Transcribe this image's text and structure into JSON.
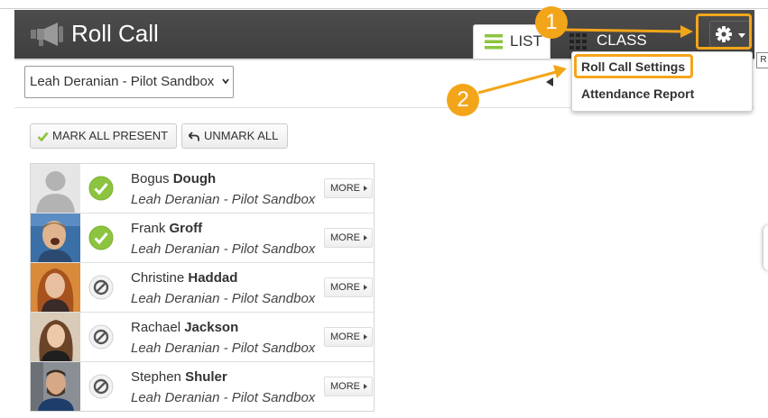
{
  "header": {
    "title": "Roll Call",
    "tabs": [
      {
        "label": "LIST",
        "active": true,
        "icon": "list-icon"
      },
      {
        "label": "CLASS",
        "active": false,
        "icon": "grid-icon"
      }
    ],
    "settings_button_icon": "gear-icon",
    "tooltip_fragment": "R"
  },
  "course_select": {
    "selected": "Leah Deranian - Pilot Sandbox"
  },
  "toolbar": {
    "mark_all_present": "MARK ALL PRESENT",
    "unmark_all": "UNMARK ALL"
  },
  "settings_menu": {
    "items": [
      {
        "label": "Roll Call Settings"
      },
      {
        "label": "Attendance Report"
      }
    ]
  },
  "callouts": [
    {
      "number": "1"
    },
    {
      "number": "2"
    }
  ],
  "students": [
    {
      "first": "Bogus",
      "last": "Dough",
      "course": "Leah Deranian - Pilot Sandbox",
      "status": "present",
      "more": "MORE"
    },
    {
      "first": "Frank",
      "last": "Groff",
      "course": "Leah Deranian - Pilot Sandbox",
      "status": "present",
      "more": "MORE"
    },
    {
      "first": "Christine",
      "last": "Haddad",
      "course": "Leah Deranian - Pilot Sandbox",
      "status": "unmarked",
      "more": "MORE"
    },
    {
      "first": "Rachael",
      "last": "Jackson",
      "course": "Leah Deranian - Pilot Sandbox",
      "status": "unmarked",
      "more": "MORE"
    },
    {
      "first": "Stephen",
      "last": "Shuler",
      "course": "Leah Deranian - Pilot Sandbox",
      "status": "unmarked",
      "more": "MORE"
    }
  ],
  "colors": {
    "header_bg": "#444444",
    "highlight": "#f3a51a",
    "present_green": "#8cc43f",
    "unmarked_gray": "#555555"
  }
}
